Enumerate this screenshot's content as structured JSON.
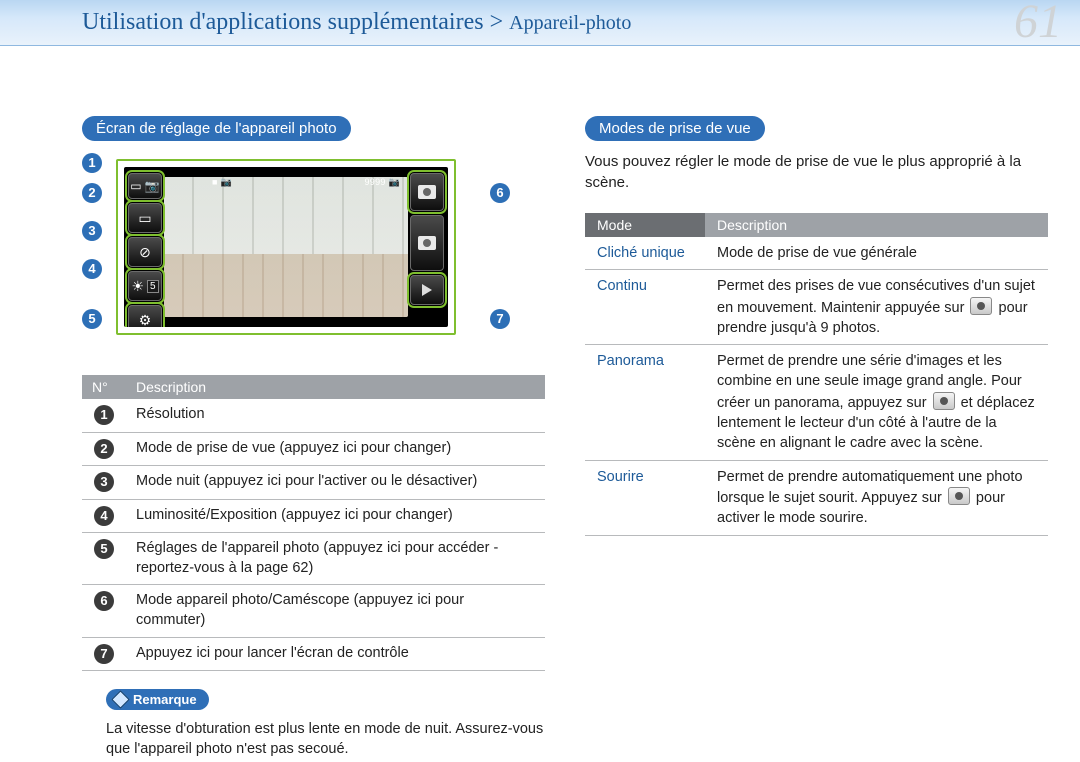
{
  "header": {
    "title": "Utilisation d'applications supplémentaires >",
    "subtitle": "Appareil-photo",
    "page_number": "61"
  },
  "left": {
    "heading": "Écran de réglage de l'appareil photo",
    "status_left": "■ 📷",
    "status_right": "9999 📷",
    "table": {
      "num_header": "N°",
      "desc_header": "Description",
      "rows": [
        {
          "n": "1",
          "desc": "Résolution"
        },
        {
          "n": "2",
          "desc": "Mode de prise de vue (appuyez ici pour changer)"
        },
        {
          "n": "3",
          "desc": "Mode nuit (appuyez ici pour l'activer ou le désactiver)"
        },
        {
          "n": "4",
          "desc": "Luminosité/Exposition (appuyez ici pour changer)"
        },
        {
          "n": "5",
          "desc": "Réglages de l'appareil photo (appuyez ici pour accéder - reportez-vous à la page 62)"
        },
        {
          "n": "6",
          "desc": "Mode appareil photo/Caméscope (appuyez ici pour commuter)"
        },
        {
          "n": "7",
          "desc": "Appuyez ici pour lancer l'écran de contrôle"
        }
      ]
    },
    "remark": {
      "label": "Remarque",
      "text": "La vitesse d'obturation est plus lente en mode de nuit. Assurez-vous que l'appareil photo n'est pas secoué."
    },
    "callouts": {
      "c1": "1",
      "c2": "2",
      "c3": "3",
      "c4": "4",
      "c5": "5",
      "c6": "6",
      "c7": "7"
    },
    "icon_labels": {
      "res": "▭ 📷",
      "mode": "▭",
      "night": "⊘",
      "exp": "☀",
      "exp_val": "5",
      "settings": "⚙"
    }
  },
  "right": {
    "heading": "Modes de prise de vue",
    "intro": "Vous pouvez régler le mode de prise de vue le plus approprié à la scène.",
    "table": {
      "mode_header": "Mode",
      "desc_header": "Description",
      "rows": [
        {
          "mode": "Cliché unique",
          "desc_a": "Mode de prise de vue générale",
          "has_icon": false,
          "desc_b": ""
        },
        {
          "mode": "Continu",
          "desc_a": "Permet des prises de vue consécutives d'un sujet en mouvement. Maintenir appuyée sur ",
          "has_icon": true,
          "desc_b": " pour prendre jusqu'à 9 photos."
        },
        {
          "mode": "Panorama",
          "desc_a": "Permet de prendre une série d'images et les combine en une seule image grand angle. Pour créer un panorama, appuyez sur ",
          "has_icon": true,
          "desc_b": " et déplacez lentement le lecteur d'un côté à l'autre de la scène en alignant le cadre avec la scène."
        },
        {
          "mode": "Sourire",
          "desc_a": "Permet de prendre automatiquement une photo lorsque le sujet sourit. Appuyez sur ",
          "has_icon": true,
          "desc_b": " pour activer le mode sourire."
        }
      ]
    }
  }
}
